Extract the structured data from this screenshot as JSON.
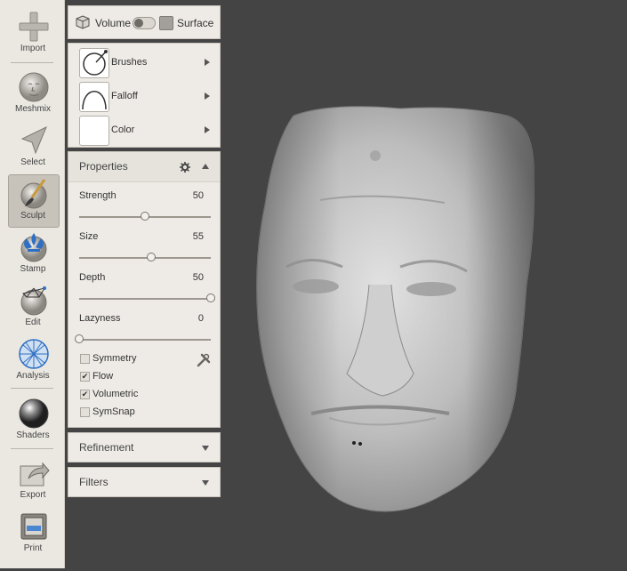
{
  "toolbar": {
    "items": [
      {
        "label": "Import",
        "icon": "plus-icon"
      },
      {
        "label": "Meshmix",
        "icon": "meshmix-face-icon"
      },
      {
        "label": "Select",
        "icon": "cursor-arrow-icon"
      },
      {
        "label": "Sculpt",
        "icon": "brush-icon",
        "active": true
      },
      {
        "label": "Stamp",
        "icon": "fleur-de-lis-icon"
      },
      {
        "label": "Edit",
        "icon": "edit-mesh-icon"
      },
      {
        "label": "Analysis",
        "icon": "analysis-sphere-icon"
      },
      {
        "label": "Shaders",
        "icon": "chrome-sphere-icon"
      },
      {
        "label": "Export",
        "icon": "export-arrow-icon"
      },
      {
        "label": "Print",
        "icon": "printer-icon"
      }
    ]
  },
  "mode": {
    "volume_label": "Volume",
    "surface_label": "Surface",
    "toggle_state": "volume"
  },
  "brush_panel": {
    "brushes_label": "Brushes",
    "falloff_label": "Falloff",
    "color_label": "Color",
    "color_value": "#ffffff"
  },
  "properties": {
    "title": "Properties",
    "sliders": [
      {
        "label": "Strength",
        "value": "50",
        "fraction": 0.5
      },
      {
        "label": "Size",
        "value": "55",
        "fraction": 0.55
      },
      {
        "label": "Depth",
        "value": "50",
        "fraction": 1.0
      },
      {
        "label": "Lazyness",
        "value": "0",
        "fraction": 0.0
      }
    ],
    "checks": [
      {
        "label": "Symmetry",
        "checked": false
      },
      {
        "label": "Flow",
        "checked": true
      },
      {
        "label": "Volumetric",
        "checked": true
      },
      {
        "label": "SymSnap",
        "checked": false
      }
    ]
  },
  "refinement": {
    "title": "Refinement"
  },
  "filters": {
    "title": "Filters"
  },
  "colors": {
    "viewport_bg": "#444444",
    "panel_bg": "#eeebe6",
    "toolbar_bg": "#ebe8e2"
  }
}
